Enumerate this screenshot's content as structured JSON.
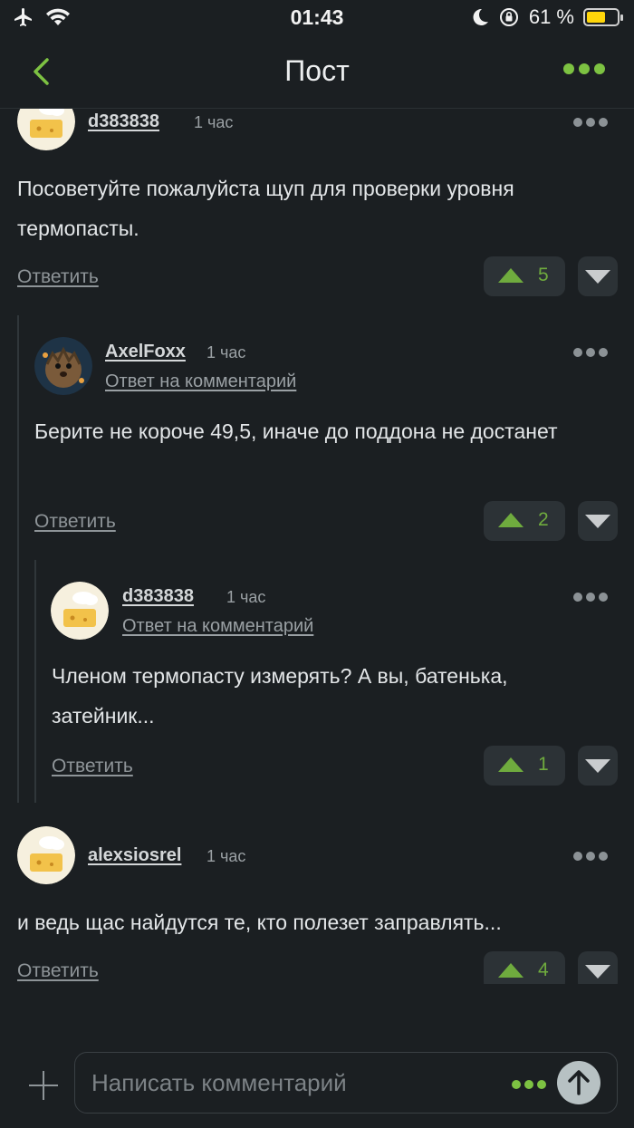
{
  "status_bar": {
    "time": "01:43",
    "battery_percent": "61 %",
    "battery_level": 0.61
  },
  "nav": {
    "title": "Пост"
  },
  "comments": [
    {
      "author": "d383838",
      "time": "1 час",
      "text": "Посоветуйте пожалуйста щуп для проверки уровня термопасты.",
      "reply_label": "Ответить",
      "votes": "5"
    },
    {
      "author": "AxelFoxx",
      "time": "1 час",
      "reply_to": "Ответ на комментарий",
      "text": "Берите не короче 49,5, иначе до поддона не достанет",
      "reply_label": "Ответить",
      "votes": "2"
    },
    {
      "author": "d383838",
      "time": "1 час",
      "reply_to": "Ответ на комментарий",
      "text": "Членом термопасту измерять? А вы, батенька, затейник...",
      "reply_label": "Ответить",
      "votes": "1"
    },
    {
      "author": "alexsiosrel",
      "time": "1 час",
      "text": "и ведь щас найдутся те, кто полезет заправлять...",
      "reply_label": "Ответить",
      "votes": "4"
    }
  ],
  "composer": {
    "placeholder": "Написать комментарий"
  },
  "colors": {
    "accent": "#7dc242",
    "background": "#1b1f22",
    "vote_green": "#6fab3e"
  },
  "icons": [
    "airplane-icon",
    "wifi-icon",
    "moon-icon",
    "orientation-lock-icon",
    "battery-icon",
    "back-chevron-icon",
    "more-icon",
    "plus-icon",
    "send-arrow-icon"
  ]
}
